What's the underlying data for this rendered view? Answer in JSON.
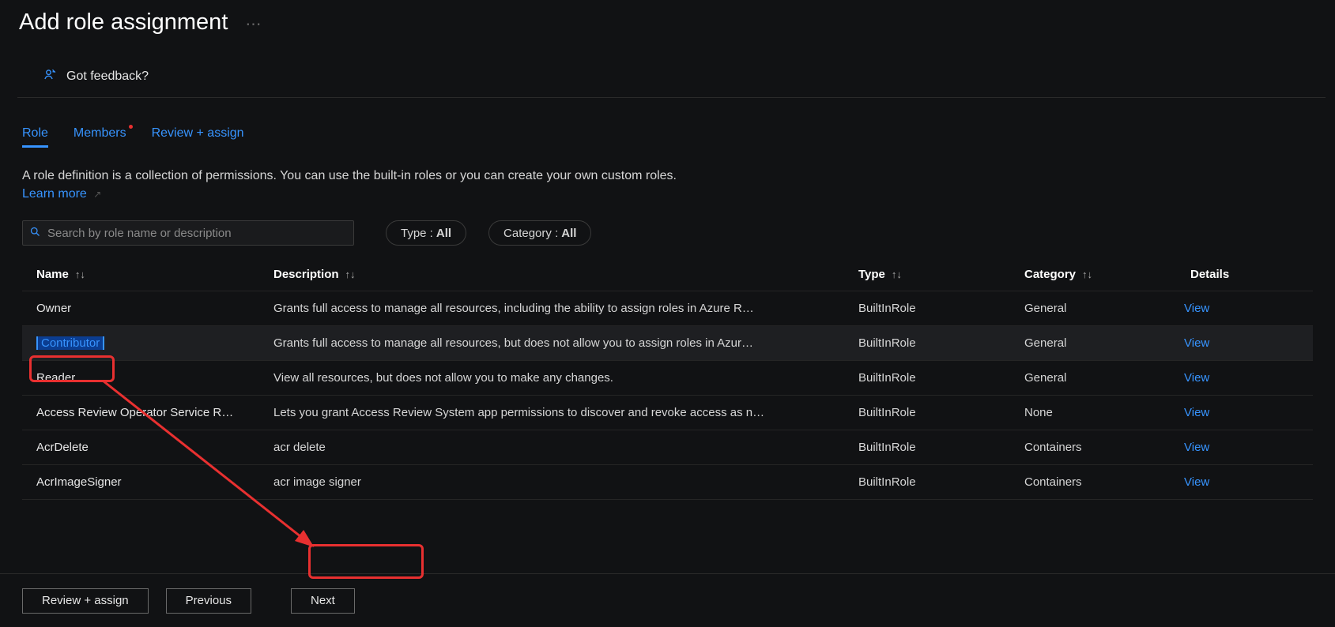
{
  "title": "Add role assignment",
  "feedback": {
    "label": "Got feedback?"
  },
  "tabs": [
    {
      "label": "Role",
      "active": true,
      "indicator": false
    },
    {
      "label": "Members",
      "active": false,
      "indicator": true
    },
    {
      "label": "Review + assign",
      "active": false,
      "indicator": false
    }
  ],
  "description": {
    "text_a": "A role definition is a collection of permissions. You can use the built-in roles or you can create your own custom roles. ",
    "learn_more": "Learn more"
  },
  "search": {
    "placeholder": "Search by role name or description"
  },
  "filters": {
    "type_label": "Type :",
    "type_value": "All",
    "category_label": "Category :",
    "category_value": "All"
  },
  "columns": {
    "name": "Name",
    "description": "Description",
    "type": "Type",
    "category": "Category",
    "details": "Details"
  },
  "rows": [
    {
      "name": "Owner",
      "description": "Grants full access to manage all resources, including the ability to assign roles in Azure R…",
      "type": "BuiltInRole",
      "category": "General",
      "details": "View",
      "selected": false
    },
    {
      "name": "Contributor",
      "description": "Grants full access to manage all resources, but does not allow you to assign roles in Azur…",
      "type": "BuiltInRole",
      "category": "General",
      "details": "View",
      "selected": true
    },
    {
      "name": "Reader",
      "description": "View all resources, but does not allow you to make any changes.",
      "type": "BuiltInRole",
      "category": "General",
      "details": "View",
      "selected": false
    },
    {
      "name": "Access Review Operator Service R…",
      "description": "Lets you grant Access Review System app permissions to discover and revoke access as n…",
      "type": "BuiltInRole",
      "category": "None",
      "details": "View",
      "selected": false
    },
    {
      "name": "AcrDelete",
      "description": "acr delete",
      "type": "BuiltInRole",
      "category": "Containers",
      "details": "View",
      "selected": false
    },
    {
      "name": "AcrImageSigner",
      "description": "acr image signer",
      "type": "BuiltInRole",
      "category": "Containers",
      "details": "View",
      "selected": false
    }
  ],
  "footer": {
    "review_assign": "Review + assign",
    "previous": "Previous",
    "next": "Next"
  }
}
